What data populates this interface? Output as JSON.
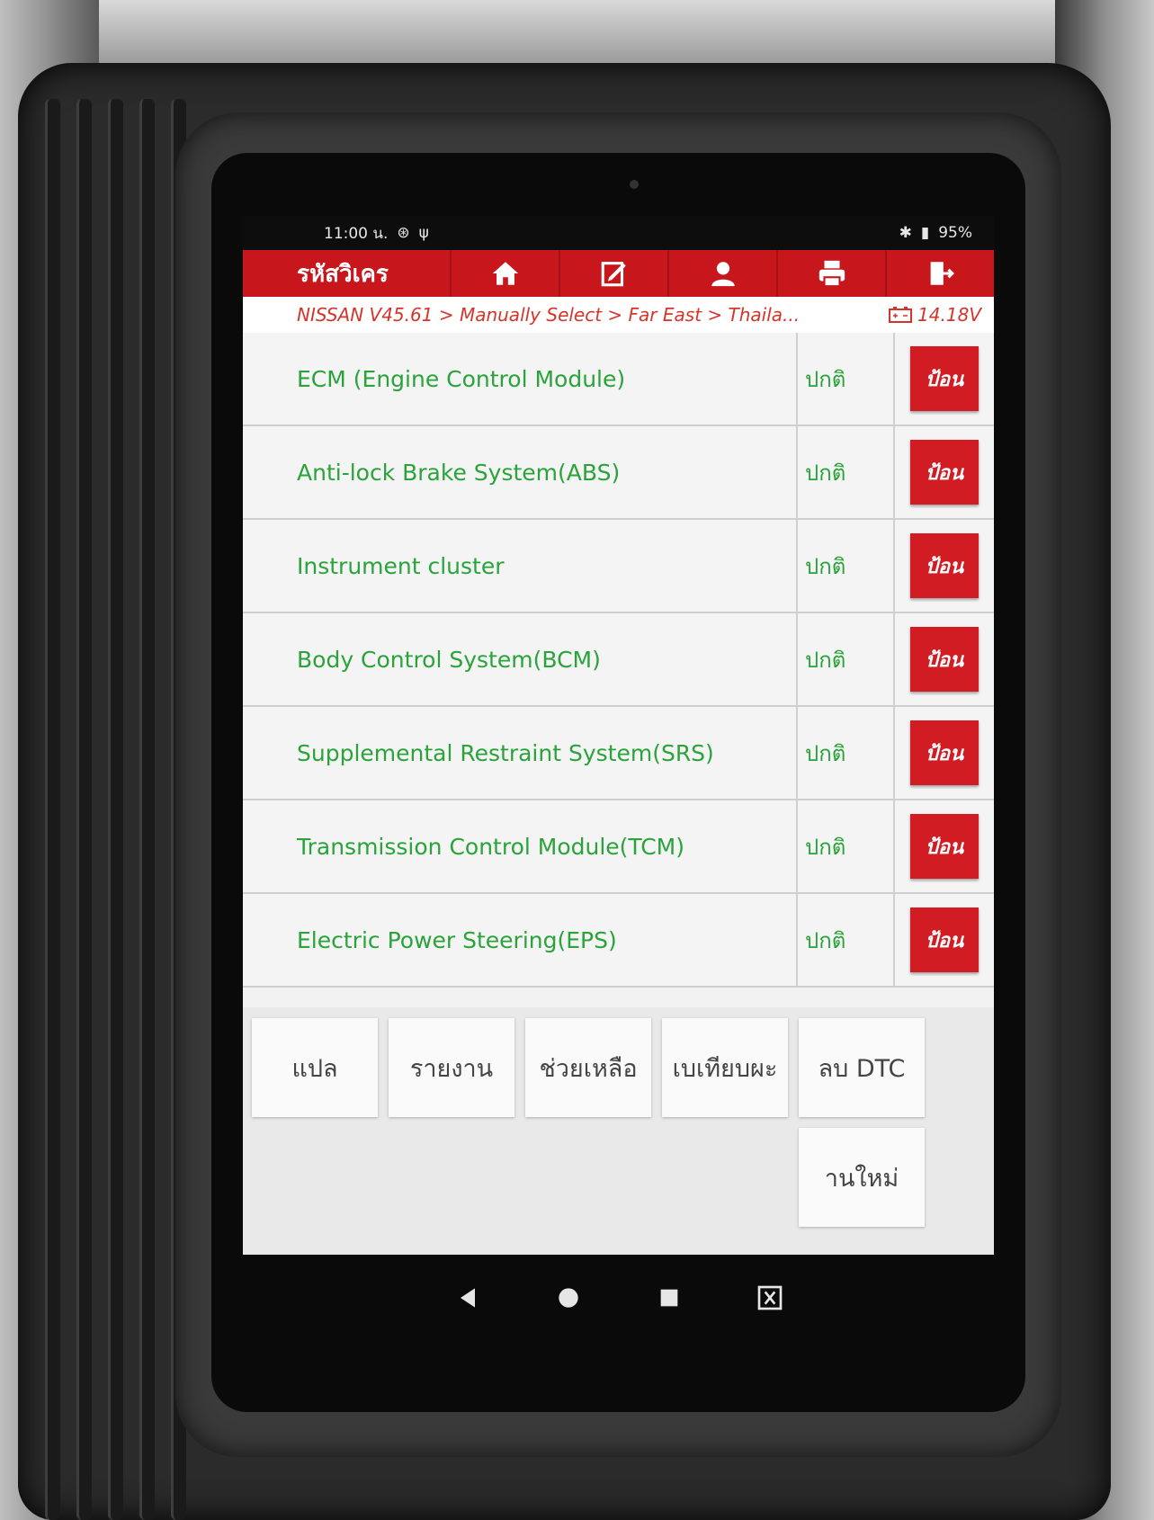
{
  "status_bar": {
    "time": "11:00 น.",
    "battery": "95%"
  },
  "app_bar": {
    "title": "รหัสวิเคร",
    "tools": [
      {
        "icon": "home-icon"
      },
      {
        "icon": "edit-icon"
      },
      {
        "icon": "user-icon"
      },
      {
        "icon": "printer-icon"
      },
      {
        "icon": "exit-icon"
      }
    ]
  },
  "breadcrumb": {
    "path": "NISSAN V45.61 > Manually Select > Far East > Thaila...",
    "voltage": "14.18V"
  },
  "systems": [
    {
      "name": "ECM (Engine Control Module)",
      "status": "ปกติ",
      "action": "ป้อน"
    },
    {
      "name": "Anti-lock Brake System(ABS)",
      "status": "ปกติ",
      "action": "ป้อน"
    },
    {
      "name": "Instrument cluster",
      "status": "ปกติ",
      "action": "ป้อน"
    },
    {
      "name": "Body Control System(BCM)",
      "status": "ปกติ",
      "action": "ป้อน"
    },
    {
      "name": "Supplemental Restraint System(SRS)",
      "status": "ปกติ",
      "action": "ป้อน"
    },
    {
      "name": "Transmission Control Module(TCM)",
      "status": "ปกติ",
      "action": "ป้อน"
    },
    {
      "name": "Electric Power Steering(EPS)",
      "status": "ปกติ",
      "action": "ป้อน"
    }
  ],
  "bottom_buttons": {
    "translate": "แปล",
    "report": "รายงาน",
    "help": "ช่วยเหลือ",
    "compare": "เบเทียบผะ",
    "clear_dtc": "ลบ DTC",
    "rescan": "านใหม่"
  },
  "colors": {
    "accent_red": "#c8161d",
    "status_green": "#2aa33a",
    "breadcrumb_red": "#d6342a"
  }
}
